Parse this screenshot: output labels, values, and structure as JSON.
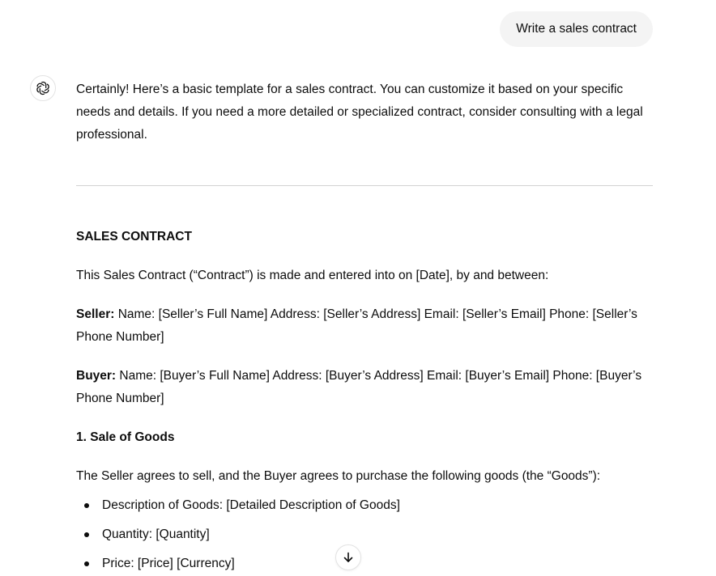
{
  "user_message": "Write a sales contract",
  "assistant": {
    "intro": "Certainly! Here’s a basic template for a sales contract. You can customize it based on your specific needs and details. If you need a more detailed or specialized contract, consider consulting with a legal professional.",
    "heading": "SALES CONTRACT",
    "opening": "This Sales Contract (“Contract”) is made and entered into on [Date], by and between:",
    "seller_label": "Seller:",
    "seller_text": " Name: [Seller’s Full Name] Address: [Seller’s Address] Email: [Seller’s Email] Phone: [Seller’s Phone Number]",
    "buyer_label": "Buyer:",
    "buyer_text": " Name: [Buyer’s Full Name] Address: [Buyer’s Address] Email: [Buyer’s Email] Phone: [Buyer’s Phone Number]",
    "section1_title": "1. Sale of Goods",
    "section1_text": "The Seller agrees to sell, and the Buyer agrees to purchase the following goods (the “Goods”):",
    "bullets": [
      "Description of Goods: [Detailed Description of Goods]",
      "Quantity: [Quantity]",
      "Price: [Price] [Currency]"
    ]
  },
  "icons": {
    "avatar": "openai-logo-icon",
    "scroll": "arrow-down-icon"
  }
}
